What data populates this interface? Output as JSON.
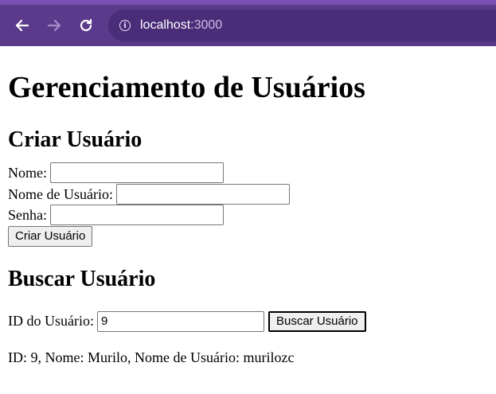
{
  "browser": {
    "url_host": "localhost",
    "url_port": ":3000",
    "info_glyph": "i"
  },
  "page": {
    "title": "Gerenciamento de Usuários",
    "create": {
      "heading": "Criar Usuário",
      "name_label": "Nome:",
      "name_value": "",
      "username_label": "Nome de Usuário:",
      "username_value": "",
      "password_label": "Senha:",
      "password_value": "",
      "submit_label": "Criar Usuário"
    },
    "search": {
      "heading": "Buscar Usuário",
      "id_label": "ID do Usuário:",
      "id_value": "9",
      "submit_label": "Buscar Usuário"
    },
    "result_text": "ID: 9, Nome: Murilo, Nome de Usuário: murilozc"
  }
}
